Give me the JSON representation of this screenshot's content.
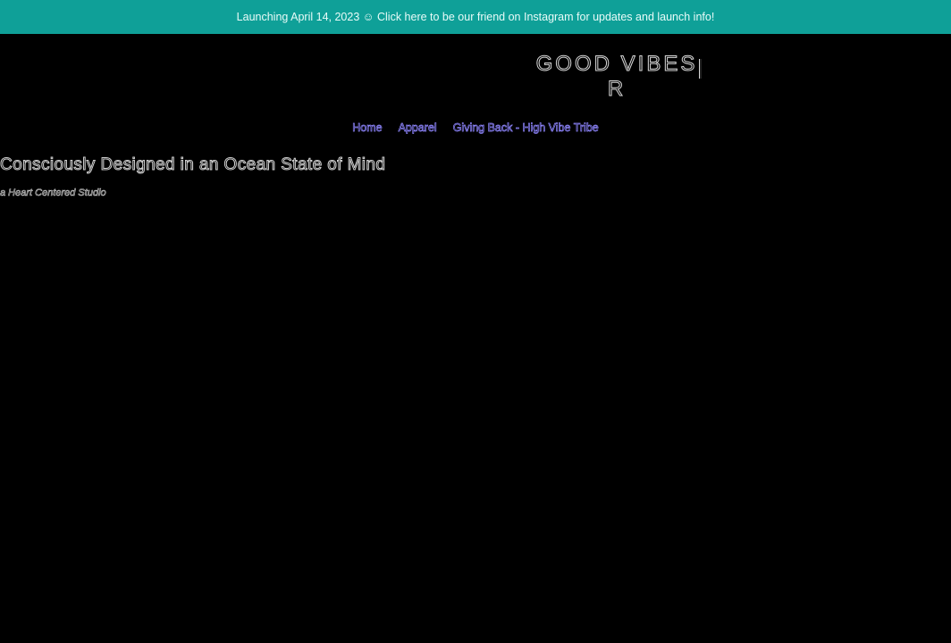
{
  "announcement": {
    "text": "Launching April 14, 2023 ☺ Click here to be our friend on Instagram for updates and launch info!"
  },
  "header": {
    "logo_line1": "GOOD VIBES",
    "logo_line2": "R"
  },
  "nav": {
    "items": [
      {
        "label": "Home"
      },
      {
        "label": "Apparel"
      },
      {
        "label": "Giving Back - High Vibe Tribe"
      }
    ]
  },
  "hero": {
    "title": "Consciously Designed in an Ocean State of Mind",
    "subtitle": "a Heart Centered Studio"
  },
  "colors": {
    "announcement_bg": "#0fa098",
    "page_bg": "#000000",
    "nav_link": "#8f86ff"
  }
}
